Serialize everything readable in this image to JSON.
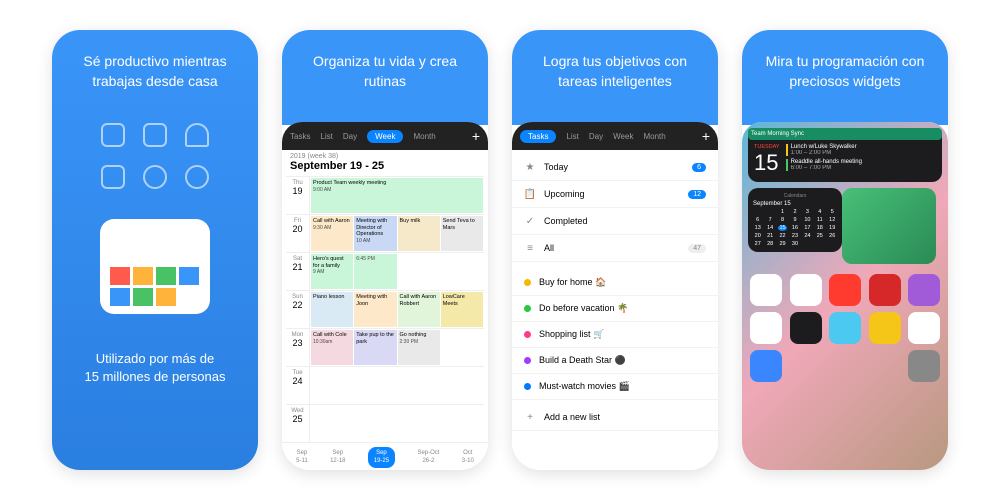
{
  "cards": [
    {
      "title": "Sé productivo mientras trabajas desde casa",
      "subtitle": "Utilizado por más de\n15 millones de personas"
    },
    {
      "title": "Organiza tu vida y crea rutinas"
    },
    {
      "title": "Logra tus objetivos con tareas inteligentes"
    },
    {
      "title": "Mira tu programación con preciosos widgets"
    }
  ],
  "calendar": {
    "tabs": [
      "Tasks",
      "List",
      "Day",
      "Week",
      "Month"
    ],
    "activeTab": "Week",
    "weekLabel": "2019 (week 38)",
    "dateRange": "September 19 - 25",
    "days": [
      {
        "dow": "Thu",
        "num": "19",
        "events": [
          {
            "t": "Product Team weekly meeting",
            "s": "9:00 AM",
            "c": "#c9f5d9"
          }
        ]
      },
      {
        "dow": "Fri",
        "num": "20",
        "events": [
          {
            "t": "Call with Aaron",
            "s": "9:30 AM",
            "c": "#fde9c9"
          },
          {
            "t": "Meeting with Director of Operations",
            "s": "10 AM",
            "c": "#c9d9f5"
          },
          {
            "t": "Buy milk",
            "s": "",
            "c": "#f5e9c9"
          },
          {
            "t": "Send Teva to Mars",
            "s": "",
            "c": "#e9e9e9"
          }
        ]
      },
      {
        "dow": "Sat",
        "num": "21",
        "events": [
          {
            "t": "Hero's quest for a family",
            "s": "9 AM",
            "c": "#c9f5d9"
          },
          {
            "t": "",
            "s": "6:45 PM",
            "c": "#c9f5d9"
          },
          {
            "t": "",
            "s": "",
            "c": ""
          },
          {
            "t": "",
            "s": "",
            "c": ""
          }
        ]
      },
      {
        "dow": "Sun",
        "num": "22",
        "events": [
          {
            "t": "Piano lesson",
            "s": "",
            "c": "#d9eaf5"
          },
          {
            "t": "Meeting with Joon",
            "s": "",
            "c": "#fde9c9"
          },
          {
            "t": "Call with Aaron Robbert",
            "s": "",
            "c": "#e0f5d9"
          },
          {
            "t": "LowCare Meets",
            "s": "",
            "c": "#f5e9a9"
          }
        ]
      },
      {
        "dow": "Mon",
        "num": "23",
        "events": [
          {
            "t": "Call with Cole",
            "s": "10:30am",
            "c": "#f5d9e0"
          },
          {
            "t": "Take pup to the park",
            "s": "",
            "c": "#d9d9f5"
          },
          {
            "t": "Go nothing",
            "s": "2:30 PM",
            "c": "#e9e9e9"
          },
          {
            "t": "",
            "s": "",
            "c": ""
          }
        ]
      },
      {
        "dow": "Tue",
        "num": "24",
        "events": []
      },
      {
        "dow": "Wed",
        "num": "25",
        "events": []
      }
    ],
    "mini": [
      "Sep\n5-11",
      "Sep\n12-18",
      "Sep\n19-25",
      "Sep-Oct\n26-2",
      "Oct\n3-10"
    ],
    "miniActive": 2
  },
  "tasks": {
    "tabs": [
      "Tasks",
      "List",
      "Day",
      "Week",
      "Month"
    ],
    "activeTab": "Tasks",
    "smart": [
      {
        "icon": "★",
        "label": "Today",
        "badge": "6",
        "k": "b"
      },
      {
        "icon": "📋",
        "label": "Upcoming",
        "badge": "12",
        "k": "b"
      },
      {
        "icon": "✓",
        "label": "Completed",
        "badge": "",
        "k": ""
      },
      {
        "icon": "≡",
        "label": "All",
        "badge": "47",
        "k": "g"
      }
    ],
    "lists": [
      {
        "c": "#f5b800",
        "label": "Buy for home 🏠"
      },
      {
        "c": "#28c840",
        "label": "Do before vacation 🌴"
      },
      {
        "c": "#ff3b8c",
        "label": "Shopping list 🛒"
      },
      {
        "c": "#a23bff",
        "label": "Build a Death Star ⚫"
      },
      {
        "c": "#007aff",
        "label": "Must-watch movies 🎬"
      }
    ],
    "add": "Add a new list"
  },
  "widgets": {
    "header": "Team Morning Sync",
    "dow": "TUESDAY",
    "dn": "15",
    "items": [
      {
        "c": "#f5c518",
        "t": "Lunch w/Luke Skywalker",
        "s": "1:00 – 2:00 PM"
      },
      {
        "c": "#48c864",
        "t": "Readdle all-hands meeting",
        "s": "6:00 – 7:00 PM"
      }
    ],
    "calLabel": "Calendars",
    "month": "September 15",
    "apps": [
      {
        "c": "#fff"
      },
      {
        "c": "#fff"
      },
      {
        "c": "#ff3b30"
      },
      {
        "c": "#d62828"
      },
      {
        "c": "#a25bd8"
      },
      {
        "c": "#fff"
      },
      {
        "c": "#1c1c1e"
      },
      {
        "c": "#4cc9f0"
      },
      {
        "c": "#f5c518"
      },
      {
        "c": "#fff"
      },
      {
        "c": "#3a86ff"
      },
      {
        "c": "#888"
      }
    ]
  }
}
